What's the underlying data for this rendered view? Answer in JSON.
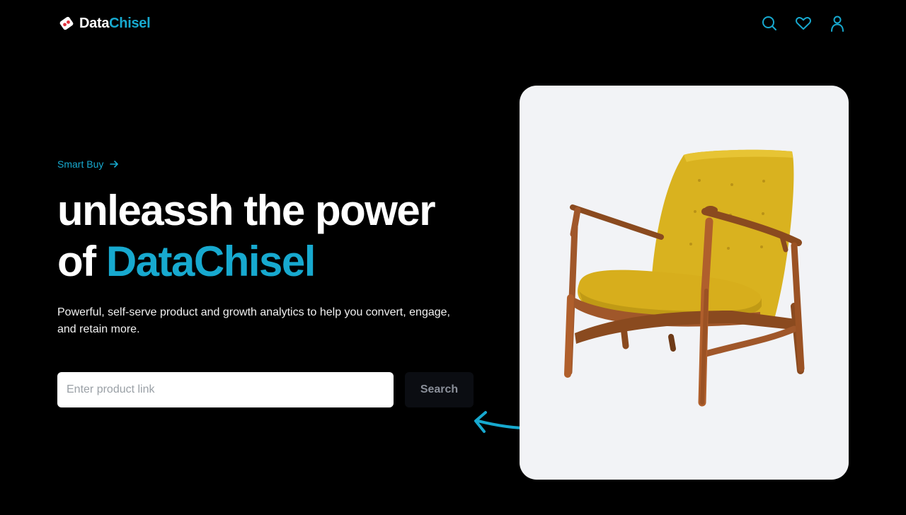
{
  "header": {
    "logo": {
      "part1": "Data",
      "part2": "Chisel"
    },
    "icons": [
      "search-icon",
      "heart-icon",
      "user-icon"
    ]
  },
  "hero": {
    "eyebrow": "Smart Buy",
    "headline_line1": "unleassh the power",
    "headline_line2_prefix": "of ",
    "headline_brand": "DataChisel",
    "subtext": "Powerful, self-serve product and growth analytics to help you convert, engage, and retain more.",
    "search": {
      "placeholder": "Enter product link",
      "value": "",
      "button_label": "Search"
    }
  },
  "product_card": {
    "image": "yellow-armchair-image"
  },
  "colors": {
    "accent": "#17a9cf",
    "background": "#000000",
    "card_bg": "#f2f3f6",
    "logo_mark": "#e0313b"
  }
}
